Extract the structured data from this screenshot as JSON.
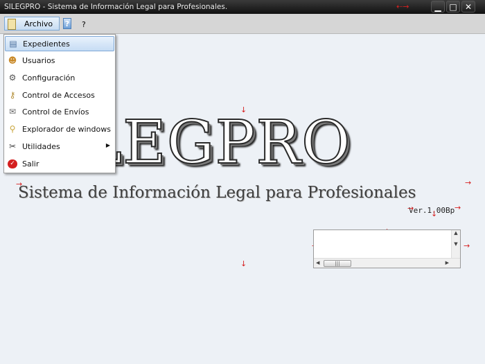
{
  "window": {
    "title": "SILEGPRO - Sistema de Información Legal para Profesionales."
  },
  "menubar": {
    "archivo": "Archivo",
    "help": "?"
  },
  "dropdown": {
    "items": [
      {
        "label": "Expedientes",
        "icon": "folder-icon"
      },
      {
        "label": "Usuarios",
        "icon": "users-icon"
      },
      {
        "label": "Configuración",
        "icon": "gear-icon"
      },
      {
        "label": "Control de Accesos",
        "icon": "access-icon"
      },
      {
        "label": "Control de Envíos",
        "icon": "envelope-icon"
      },
      {
        "label": "Explorador de windows",
        "icon": "explorer-icon"
      },
      {
        "label": "Utilidades",
        "icon": "tools-icon"
      },
      {
        "label": "Salir",
        "icon": "exit-icon"
      }
    ]
  },
  "logo": {
    "main": "SILEGPRO",
    "subtitle": "Sistema de Información Legal para Profesionales",
    "version": "Ver.1.00Bp"
  },
  "colors": {
    "menu_highlight": "#c6dcf4",
    "arrow": "#d62020",
    "titlebar": "#111111",
    "background": "#edf1f6"
  }
}
